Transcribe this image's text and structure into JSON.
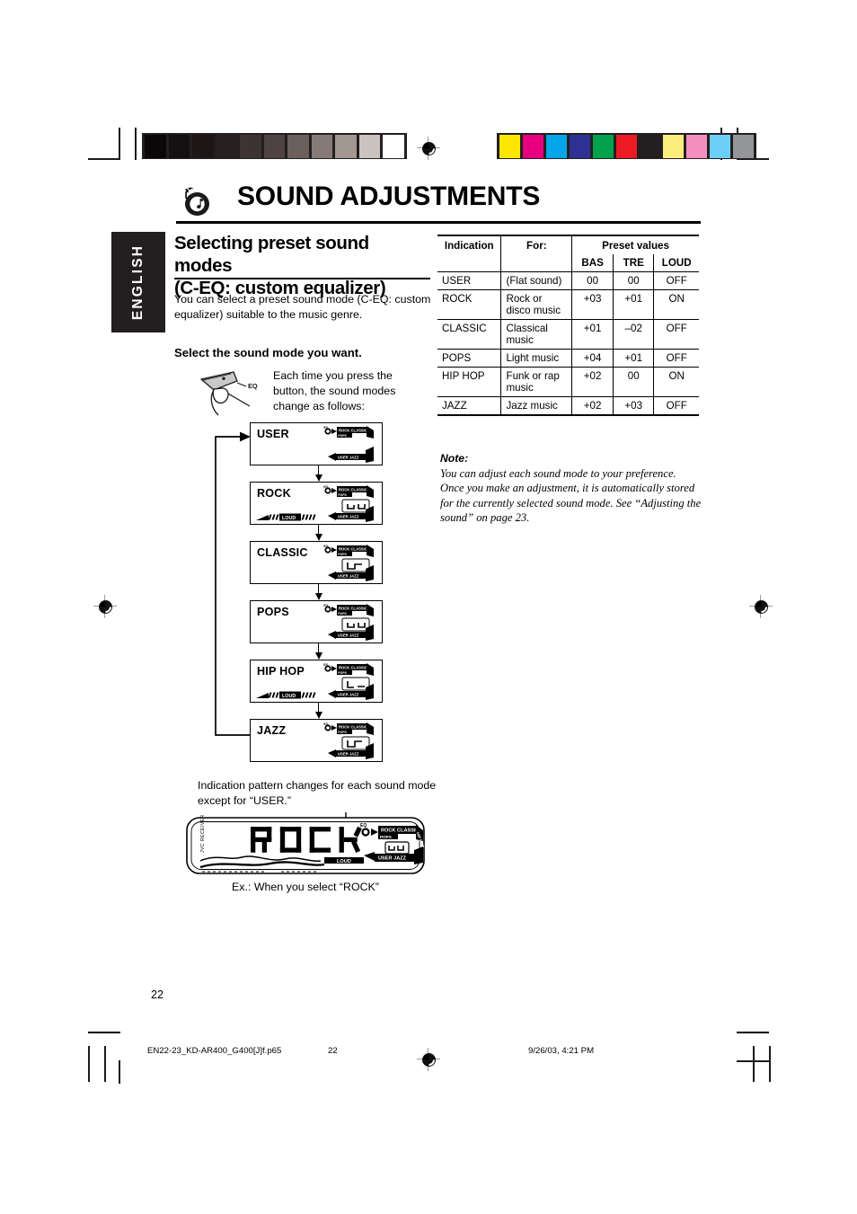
{
  "document": {
    "language_tab": "ENGLISH",
    "page_number": "22",
    "chapter_title": "SOUND ADJUSTMENTS",
    "chapter_icon": "music-note-blob-icon"
  },
  "section": {
    "title_line1": "Selecting preset sound modes",
    "title_line2": "(C-EQ: custom equalizer)",
    "intro": "You can select a preset sound mode (C-EQ: custom equalizer) suitable to the music genre.",
    "step_heading": "Select the sound mode you want.",
    "press_note": "Each time you press the button, the sound modes change as follows:",
    "button_label": "EQ",
    "indication_caption": "Indication pattern changes for each sound mode except for “USER.”",
    "example_caption": "Ex.: When you select “ROCK”",
    "display_text": "ROCK"
  },
  "flow": {
    "modes": [
      {
        "name": "USER",
        "loud": false
      },
      {
        "name": "ROCK",
        "loud": true
      },
      {
        "name": "CLASSIC",
        "loud": false
      },
      {
        "name": "POPS",
        "loud": false
      },
      {
        "name": "HIP HOP",
        "loud": true
      },
      {
        "name": "JAZZ",
        "loud": false
      }
    ],
    "loud_label": "LOUD",
    "lcd_top_labels": "ROCK CLASSIC",
    "lcd_mid_label": "POPS",
    "lcd_bottom_labels": "USER  JAZZ",
    "lcd_side_label": "HIP HOP"
  },
  "table": {
    "headers": {
      "indication": "Indication",
      "for": "For:",
      "preset_values": "Preset values",
      "bas": "BAS",
      "tre": "TRE",
      "loud": "LOUD"
    },
    "rows": [
      {
        "indication": "USER",
        "for": "(Flat sound)",
        "bas": "00",
        "tre": "00",
        "loud": "OFF"
      },
      {
        "indication": "ROCK",
        "for": "Rock or disco music",
        "bas": "+03",
        "tre": "+01",
        "loud": "ON"
      },
      {
        "indication": "CLASSIC",
        "for": "Classical music",
        "bas": "+01",
        "tre": "–02",
        "loud": "OFF"
      },
      {
        "indication": "POPS",
        "for": "Light music",
        "bas": "+04",
        "tre": "+01",
        "loud": "OFF"
      },
      {
        "indication": "HIP HOP",
        "for": "Funk or rap music",
        "bas": "+02",
        "tre": "00",
        "loud": "ON"
      },
      {
        "indication": "JAZZ",
        "for": "Jazz music",
        "bas": "+02",
        "tre": "+03",
        "loud": "OFF"
      }
    ]
  },
  "note": {
    "label": "Note:",
    "body": "You can adjust each sound mode to your preference. Once you make an adjustment, it is automatically stored for the currently selected sound mode. See “Adjusting the sound”  on page 23."
  },
  "footer": {
    "file_name": "EN22-23_KD-AR400_G400[J]f.p65",
    "page": "22",
    "timestamp": "9/26/03, 4:21 PM"
  },
  "print_marks": {
    "gray_swatches": [
      "#0a0708",
      "#140f10",
      "#1d1617",
      "#272021",
      "#3d3333",
      "#4e4341",
      "#6b5f5b",
      "#857a75",
      "#a29891",
      "#cbc3bd",
      "#ffffff"
    ],
    "color_swatches": [
      "#fce700",
      "#e6007e",
      "#00a6e8",
      "#2e3192",
      "#00a14b",
      "#ed1c24",
      "#231f20",
      "#faed7c",
      "#f48fc0",
      "#6ecff6",
      "#939598"
    ]
  }
}
